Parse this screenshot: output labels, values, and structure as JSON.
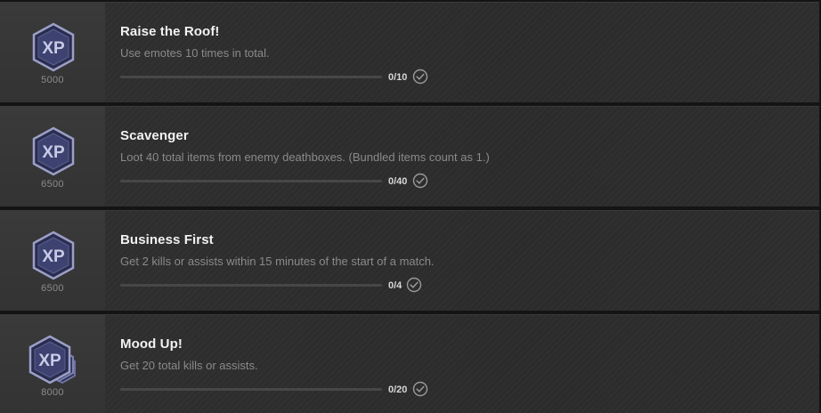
{
  "challenges": [
    {
      "title": "Raise the Roof!",
      "description": "Use emotes 10 times in total.",
      "reward_xp": "5000",
      "progress_text": "0/10",
      "progress_fraction": 0,
      "badge_icon": "xp-badge-icon",
      "complete_icon": "checkmark-circle-icon"
    },
    {
      "title": "Scavenger",
      "description": "Loot 40 total items from enemy deathboxes. (Bundled items count as 1.)",
      "reward_xp": "6500",
      "progress_text": "0/40",
      "progress_fraction": 0,
      "badge_icon": "xp-badge-icon",
      "complete_icon": "checkmark-circle-icon"
    },
    {
      "title": "Business First",
      "description": "Get 2 kills or assists within 15 minutes of the start of a match.",
      "reward_xp": "6500",
      "progress_text": "0/4",
      "progress_fraction": 0,
      "badge_icon": "xp-badge-icon",
      "complete_icon": "checkmark-circle-icon"
    },
    {
      "title": "Mood Up!",
      "description": "Get 20 total kills or assists.",
      "reward_xp": "8000",
      "progress_text": "0/20",
      "progress_fraction": 0,
      "badge_icon": "xp-badge-stacked-icon",
      "complete_icon": "checkmark-circle-icon"
    }
  ],
  "colors": {
    "badge_fill": "#3d4270",
    "badge_rim": "#8a8fb8",
    "badge_text": "#c9cbe6"
  }
}
